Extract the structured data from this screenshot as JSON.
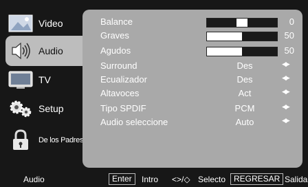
{
  "sidebar": {
    "items": [
      {
        "label": "Video",
        "icon": "video-icon"
      },
      {
        "label": "Audio",
        "icon": "speaker-icon"
      },
      {
        "label": "TV",
        "icon": "tv-icon"
      },
      {
        "label": "Setup",
        "icon": "gears-icon"
      },
      {
        "label": "De los Padres",
        "icon": "lock-icon"
      }
    ],
    "active_index": 1
  },
  "settings": {
    "balance": {
      "label": "Balance",
      "value": "0",
      "level": 0.5
    },
    "graves": {
      "label": "Graves",
      "value": "50",
      "level": 0.5
    },
    "agudos": {
      "label": "Agudos",
      "value": "50",
      "level": 0.5
    },
    "surround": {
      "label": "Surround",
      "value": "Des"
    },
    "ecualizador": {
      "label": "Ecualizador",
      "value": "Des"
    },
    "altavoces": {
      "label": "Altavoces",
      "value": "Act"
    },
    "tipo_spdif": {
      "label": "Tipo SPDIF",
      "value": "PCM"
    },
    "audio_seleccione": {
      "label": "Audio seleccione",
      "value": "Auto"
    }
  },
  "footer": {
    "current": "Audio",
    "enter_key": "Enter",
    "enter_action": "Intro",
    "nav_keys": "<>/◇",
    "nav_action": "Selecto",
    "back_key": "REGRESAR",
    "back_action": "Salida"
  },
  "colors": {
    "panel": "#a9a9a9",
    "active_tab": "#bdbdbd",
    "background": "#171717"
  }
}
